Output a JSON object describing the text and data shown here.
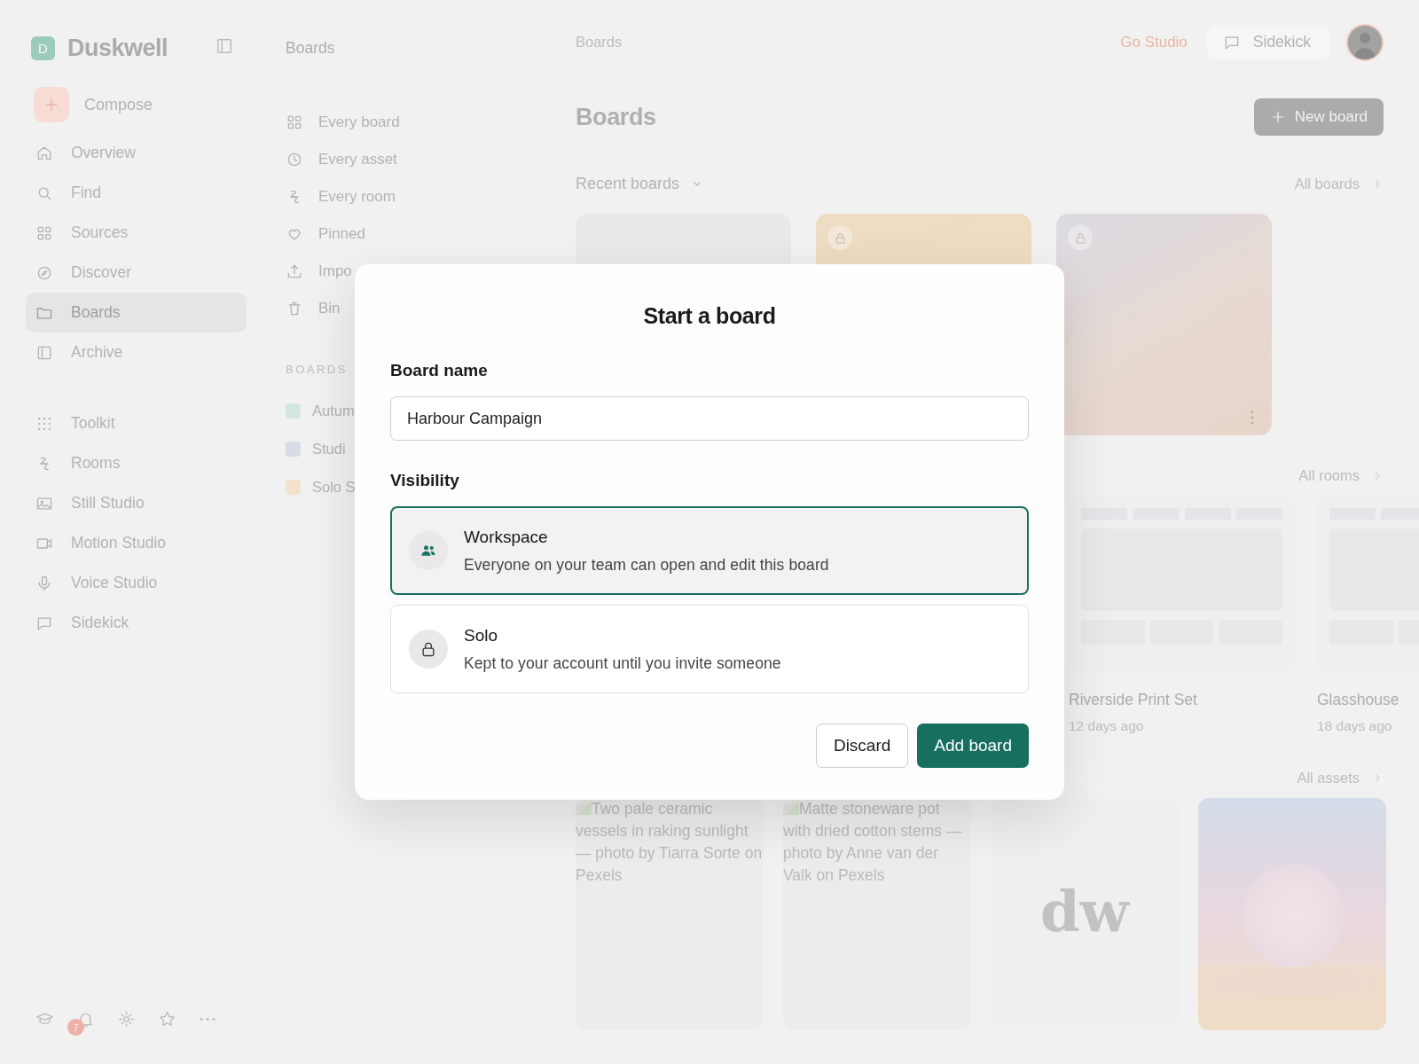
{
  "app": {
    "logo_letter": "D",
    "name": "Duskwell"
  },
  "compose": {
    "label": "Compose"
  },
  "sidebar": {
    "nav": [
      {
        "label": "Overview",
        "selected": false
      },
      {
        "label": "Find",
        "selected": false
      },
      {
        "label": "Sources",
        "selected": false
      },
      {
        "label": "Discover",
        "selected": false
      },
      {
        "label": "Boards",
        "selected": true
      },
      {
        "label": "Archive",
        "selected": false
      }
    ],
    "tools": [
      {
        "label": "Toolkit",
        "selected": false
      },
      {
        "label": "Rooms",
        "selected": false
      },
      {
        "label": "Still Studio",
        "selected": false
      },
      {
        "label": "Motion Studio",
        "selected": false
      },
      {
        "label": "Voice Studio",
        "selected": false
      },
      {
        "label": "Sidekick",
        "selected": false
      }
    ],
    "notification_count": "7"
  },
  "subnav": {
    "title": "Boards",
    "items": [
      {
        "label": "Every board",
        "selected": false
      },
      {
        "label": "Every asset",
        "selected": false
      },
      {
        "label": "Every room",
        "selected": false
      },
      {
        "label": "Pinned",
        "selected": false
      },
      {
        "label": "Impo",
        "selected": false
      },
      {
        "label": "Bin",
        "selected": false
      }
    ],
    "section_label": "BOARDS",
    "boards": [
      {
        "label": "Autum",
        "color": "#d3e6e1"
      },
      {
        "label": "Studi",
        "color": "#d9dbe6"
      },
      {
        "label": "Solo S",
        "color": "#f2e2cd"
      }
    ]
  },
  "top_bar": {
    "breadcrumb": "Boards",
    "go_studio": "Go Studio",
    "sidekick": "Sidekick"
  },
  "page": {
    "title": "Boards",
    "new_board": "New board"
  },
  "recent": {
    "heading": "Recent boards",
    "link": "All boards",
    "cards": [
      {
        "locked": false,
        "menu": false
      },
      {
        "locked": true,
        "menu": false
      },
      {
        "locked": true,
        "menu": true
      }
    ]
  },
  "rooms": {
    "link": "All rooms",
    "items": [
      {
        "title": "Riverside Print Set",
        "time": "12 days ago"
      },
      {
        "title": "Glasshouse",
        "time": "18 days ago"
      }
    ]
  },
  "assets": {
    "link": "All assets",
    "items": [
      {
        "kind": "broken_image",
        "alt": "Two pale ceramic vessels in raking sunlight — photo by Tiarra Sorte on Pexels"
      },
      {
        "kind": "broken_image",
        "alt": "Matte stoneware pot with dried cotton stems — photo by Anne van der Valk on Pexels"
      },
      {
        "kind": "monogram",
        "text": "dw"
      },
      {
        "kind": "picture"
      }
    ]
  },
  "modal": {
    "title": "Start a board",
    "name_label": "Board name",
    "name_value": "Harbour Campaign",
    "visibility_label": "Visibility",
    "options": [
      {
        "title": "Workspace",
        "description": "Everyone on your team can open and edit this board",
        "selected": true
      },
      {
        "title": "Solo",
        "description": "Kept to your account until you invite someone",
        "selected": false
      }
    ],
    "discard": "Discard",
    "confirm": "Add board"
  }
}
